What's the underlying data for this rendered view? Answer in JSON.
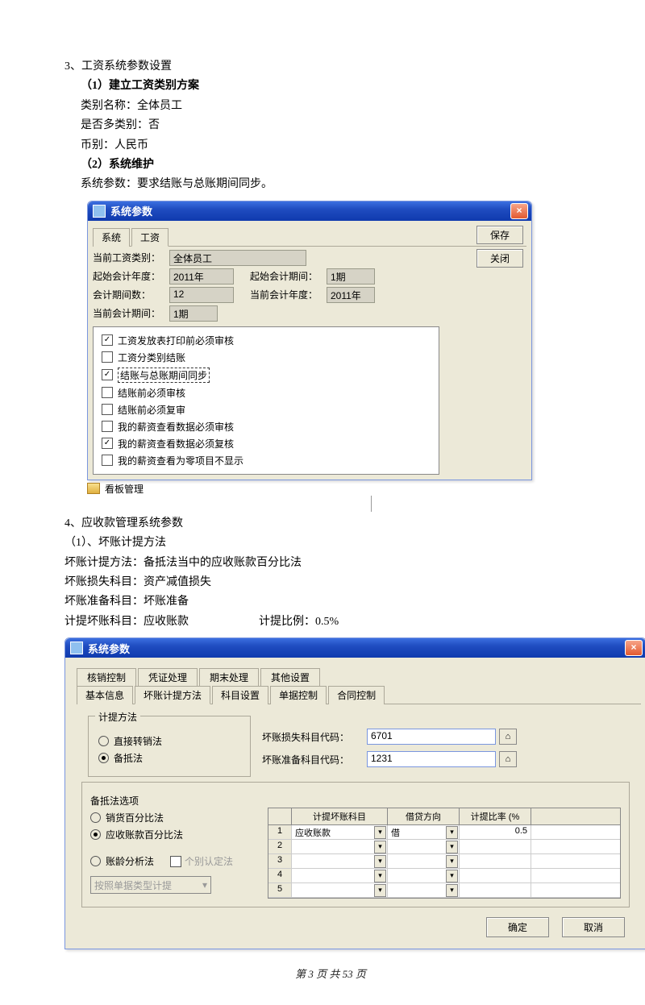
{
  "doc": {
    "sec3_title": "3、工资系统参数设置",
    "sec3_1": "（1）建立工资类别方案",
    "catname": "类别名称：全体员工",
    "multi": "是否多类别：否",
    "currency": "币别：人民币",
    "sec3_2": "（2）系统维护",
    "sysparam_text": "系统参数：要求结账与总账期间同步。",
    "kanban": "看板管理",
    "sec4_title": "4、应收款管理系统参数",
    "sec4_1": "（1）、坏账计提方法",
    "method_line": "坏账计提方法：备抵法当中的应收账款百分比法",
    "loss_line": "坏账损失科目：资产减值损失",
    "reserve_line": "坏账准备科目：坏账准备",
    "account_line": "计提坏账科目：应收账款",
    "ratio_label": "计提比例：",
    "ratio_value": "0.5%",
    "footer": "第 3 页 共 53 页"
  },
  "win1": {
    "title": "系统参数",
    "tabs": [
      "系统",
      "工资"
    ],
    "fields": {
      "current_category_lbl": "当前工资类别：",
      "current_category": "全体员工",
      "start_year_lbl": "起始会计年度：",
      "start_year": "2011年",
      "start_period_lbl": "起始会计期间：",
      "start_period": "1期",
      "period_count_lbl": "会计期间数：",
      "period_count": "12",
      "current_year_lbl": "当前会计年度：",
      "current_year": "2011年",
      "current_period_lbl": "当前会计期间：",
      "current_period": "1期"
    },
    "checks": [
      {
        "label": "工资发放表打印前必须审核",
        "checked": true
      },
      {
        "label": "工资分类别结账",
        "checked": false
      },
      {
        "label": "结账与总账期间同步",
        "checked": true,
        "highlight": true
      },
      {
        "label": "结账前必须审核",
        "checked": false
      },
      {
        "label": "结账前必须复审",
        "checked": false
      },
      {
        "label": "我的薪资查看数据必须审核",
        "checked": false
      },
      {
        "label": "我的薪资查看数据必须复核",
        "checked": true
      },
      {
        "label": "我的薪资查看为零项目不显示",
        "checked": false
      }
    ],
    "buttons": {
      "save": "保存",
      "close": "关闭"
    }
  },
  "win2": {
    "title": "系统参数",
    "tabs_row1": [
      "核销控制",
      "凭证处理",
      "期末处理",
      "其他设置"
    ],
    "tabs_row2": [
      "基本信息",
      "坏账计提方法",
      "科目设置",
      "单据控制",
      "合同控制"
    ],
    "method_group": {
      "legend": "计提方法",
      "opt1": "直接转销法",
      "opt2": "备抵法"
    },
    "loss_code_lbl": "坏账损失科目代码：",
    "loss_code": "6701",
    "reserve_code_lbl": "坏账准备科目代码：",
    "reserve_code": "1231",
    "backup_group": {
      "legend": "备抵法选项",
      "opt1": "销货百分比法",
      "opt2": "应收账款百分比法",
      "opt3": "账龄分析法",
      "opt4": "个别认定法",
      "dropdown": "按照单据类型计提"
    },
    "table": {
      "headers": [
        "计提坏账科目",
        "借贷方向",
        "计提比率 (%"
      ],
      "rownums": [
        "1",
        "2",
        "3",
        "4",
        "5"
      ],
      "row1_subject": "应收账款",
      "row1_dir": "借",
      "row1_rate": "0.5"
    },
    "buttons": {
      "ok": "确定",
      "cancel": "取消"
    }
  }
}
